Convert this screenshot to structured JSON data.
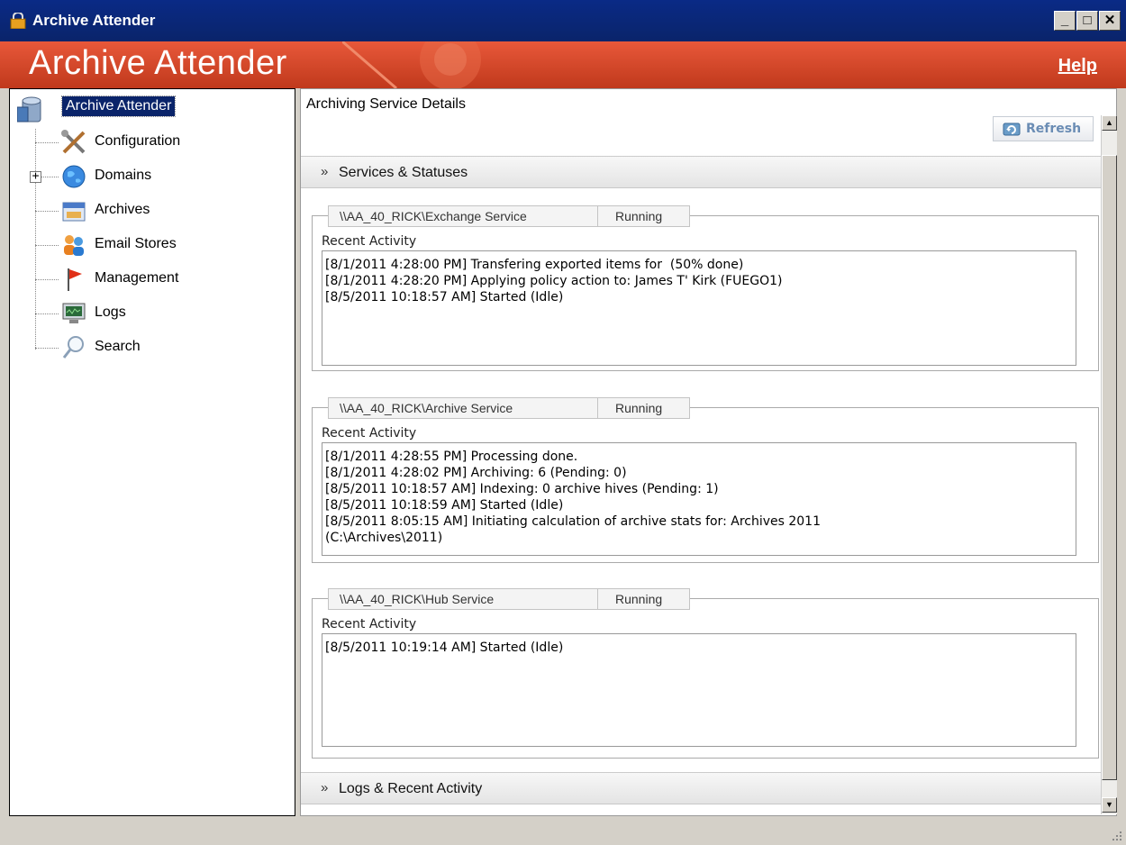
{
  "window": {
    "title": "Archive Attender",
    "buttons": {
      "minimize": "_",
      "maximize": "□",
      "close": "✕"
    }
  },
  "banner": {
    "title": "Archive Attender",
    "help_label": "Help"
  },
  "tree": {
    "root_label": "Archive Attender",
    "expander": "+",
    "items": [
      {
        "label": "Configuration",
        "icon": "tools-icon"
      },
      {
        "label": "Domains",
        "icon": "globe-icon"
      },
      {
        "label": "Archives",
        "icon": "archive-box-icon"
      },
      {
        "label": "Email Stores",
        "icon": "users-icon"
      },
      {
        "label": "Management",
        "icon": "flag-icon"
      },
      {
        "label": "Logs",
        "icon": "monitor-icon"
      },
      {
        "label": "Search",
        "icon": "magnifier-icon"
      }
    ]
  },
  "main": {
    "title": "Archiving Service Details",
    "refresh_label": "Refresh",
    "sections": {
      "services": "Services & Statuses",
      "logs": "Logs & Recent Activity"
    },
    "chevron": "»",
    "recent_activity_label": "Recent Activity",
    "services": [
      {
        "name": "\\\\AA_40_RICK\\Exchange Service",
        "status": "Running",
        "activity": [
          "[8/1/2011 4:28:00 PM] Transfering exported items for  (50% done)",
          "[8/1/2011 4:28:20 PM] Applying policy action to: James T' Kirk (FUEGO1)",
          "[8/5/2011 10:18:57 AM] Started (Idle)"
        ]
      },
      {
        "name": "\\\\AA_40_RICK\\Archive Service",
        "status": "Running",
        "activity": [
          "[8/1/2011 4:28:55 PM] Processing done.",
          "[8/1/2011 4:28:02 PM] Archiving: 6 (Pending: 0)",
          "[8/5/2011 10:18:57 AM] Indexing: 0 archive hives (Pending: 1)",
          "[8/5/2011 10:18:59 AM] Started (Idle)",
          "[8/5/2011 8:05:15 AM] Initiating calculation of archive stats for: Archives 2011",
          "(C:\\Archives\\2011)"
        ]
      },
      {
        "name": "\\\\AA_40_RICK\\Hub Service",
        "status": "Running",
        "activity": [
          "[8/5/2011 10:19:14 AM] Started (Idle)"
        ]
      }
    ]
  },
  "scrollbar": {
    "up": "▲",
    "down": "▼"
  },
  "colors": {
    "titlebar": "#0a246a",
    "banner": "#d4482a",
    "selection": "#0a246a"
  }
}
